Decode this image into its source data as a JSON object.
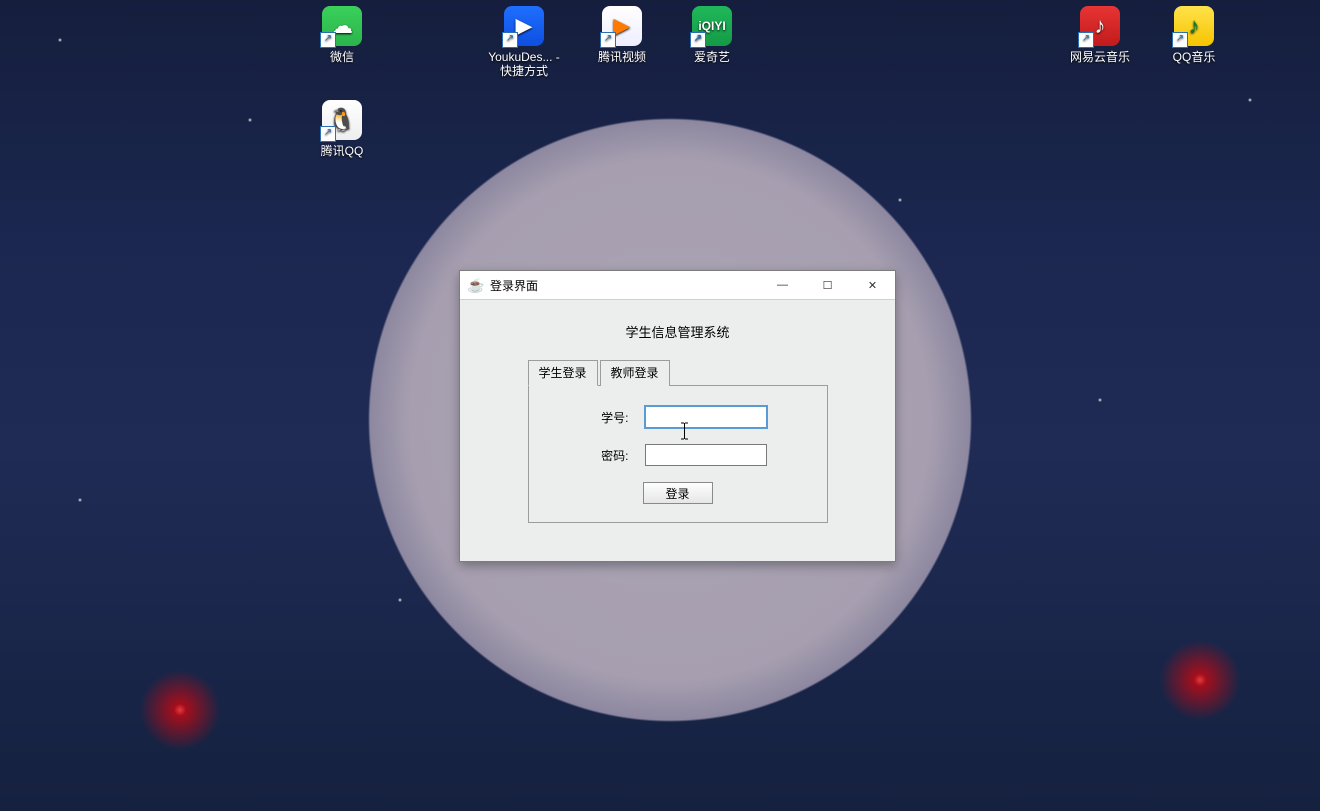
{
  "desktop_icons": [
    {
      "id": "wechat",
      "label": "微信",
      "glyph": "☁",
      "cls": "wechat"
    },
    {
      "id": "youku",
      "label": "YoukuDes... - 快捷方式",
      "glyph": "▶",
      "cls": "youku"
    },
    {
      "id": "tencentv",
      "label": "腾讯视频",
      "glyph": "▶",
      "cls": "tencentv"
    },
    {
      "id": "iqiyi",
      "label": "爱奇艺",
      "glyph": "iQIYI",
      "cls": "iqiyi"
    },
    {
      "id": "netease",
      "label": "网易云音乐",
      "glyph": "♪",
      "cls": "netease"
    },
    {
      "id": "qqmusic",
      "label": "QQ音乐",
      "glyph": "♪",
      "cls": "qqmusic"
    },
    {
      "id": "qq",
      "label": "腾讯QQ",
      "glyph": "🐧",
      "cls": "qq"
    }
  ],
  "window": {
    "title": "登录界面",
    "system_title": "学生信息管理系统",
    "tabs": [
      {
        "id": "student",
        "label": "学生登录",
        "active": true
      },
      {
        "id": "teacher",
        "label": "教师登录",
        "active": false
      }
    ],
    "fields": {
      "student_id_label": "学号:",
      "student_id_value": "",
      "password_label": "密码:",
      "password_value": ""
    },
    "login_button": "登录",
    "controls": {
      "minimize": "—",
      "maximize": "☐",
      "close": "✕"
    }
  }
}
